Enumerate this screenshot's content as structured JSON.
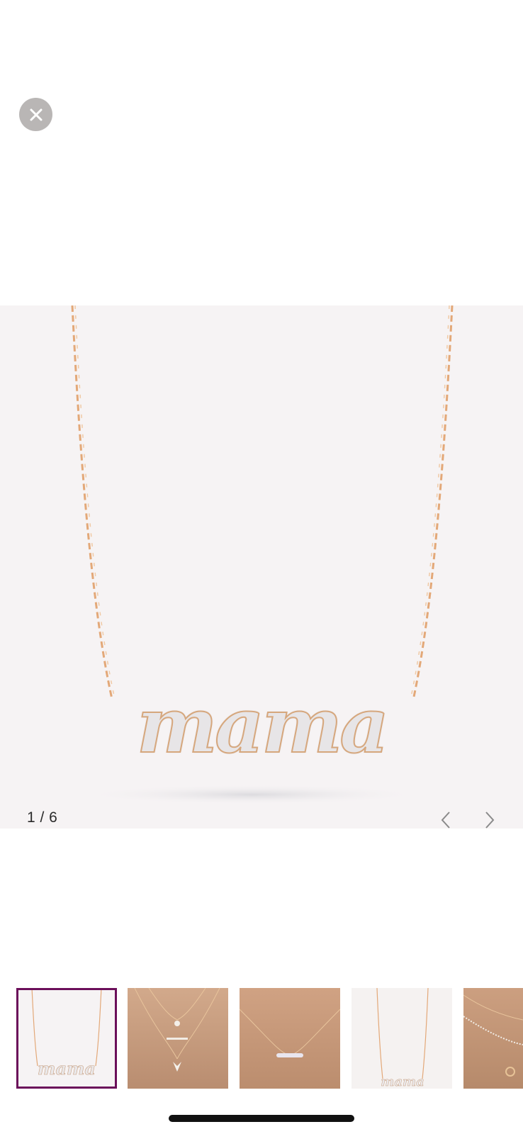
{
  "gallery": {
    "counter_text": "1 / 6",
    "current": 1,
    "total": 6,
    "background_color": "#f6f3f4",
    "chain_color": "#e3a878"
  },
  "product": {
    "pendant_text": "mama"
  },
  "controls": {
    "close_icon": "close-icon",
    "prev_icon": "chevron-left-icon",
    "next_icon": "chevron-right-icon"
  },
  "thumbnails": [
    {
      "index": 1,
      "active": true,
      "bg": "#f6f3f4"
    },
    {
      "index": 2,
      "active": false,
      "bg": "#c99e80"
    },
    {
      "index": 3,
      "active": false,
      "bg": "#c79878"
    },
    {
      "index": 4,
      "active": false,
      "bg": "#f5f2f1"
    },
    {
      "index": 5,
      "active": false,
      "bg": "#c59879"
    }
  ],
  "accent_color": "#6b0f5a"
}
